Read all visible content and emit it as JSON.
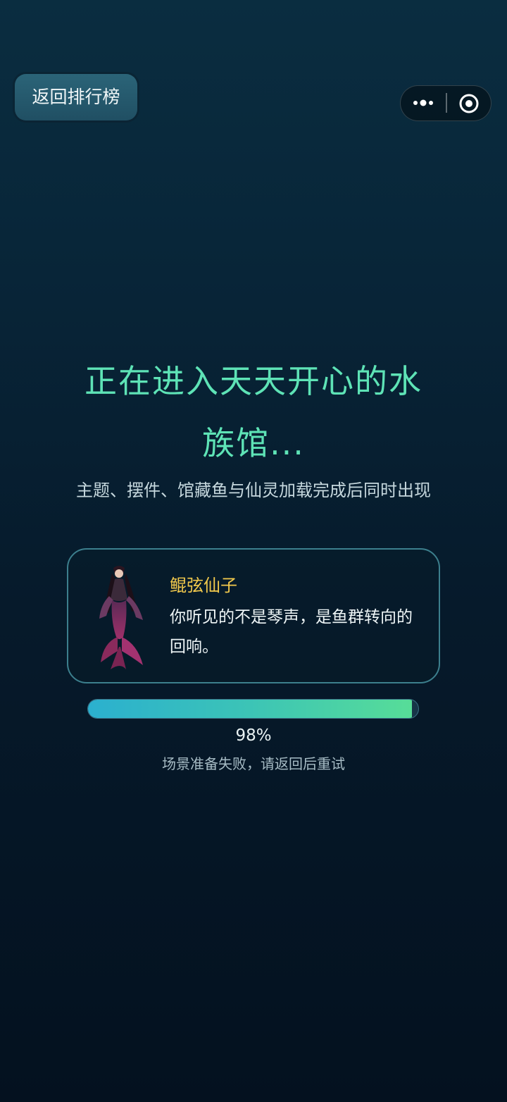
{
  "header": {
    "back_label": "返回排行榜"
  },
  "capsule": {
    "more_icon": "more-dots-icon",
    "close_icon": "target-circle-icon"
  },
  "main": {
    "title": "正在进入天天开心的水族馆...",
    "subtitle": "主题、摆件、馆藏鱼与仙灵加载完成后同时出现"
  },
  "spirit_card": {
    "name": "鲲弦仙子",
    "quote": "你听见的不是琴声，是鱼群转向的回响。",
    "portrait_icon": "mermaid-fairy-portrait"
  },
  "progress": {
    "value": 0.98,
    "percent_label": "98%",
    "status": "场景准备失败，请返回后重试"
  },
  "colors": {
    "title": "#5ee3b6",
    "name": "#f2c94c",
    "fill_start": "#2bb0cf",
    "fill_end": "#57dd98"
  }
}
